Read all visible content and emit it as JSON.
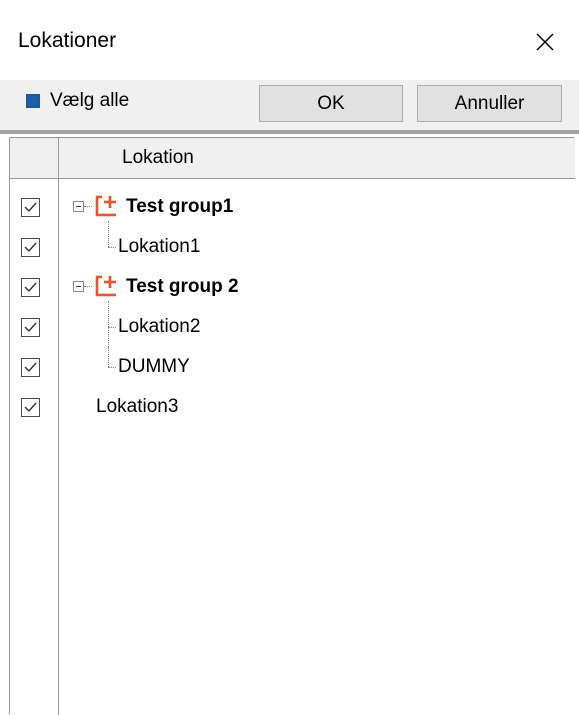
{
  "window": {
    "title": "Lokationer"
  },
  "toolbar": {
    "select_all_label": "Vælg alle",
    "ok_label": "OK",
    "cancel_label": "Annuller"
  },
  "grid": {
    "column_header": "Lokation",
    "rows": [
      {
        "label": "Test group1",
        "checked": true,
        "type": "group"
      },
      {
        "label": "Lokation1",
        "checked": true,
        "type": "child"
      },
      {
        "label": "Test group 2",
        "checked": true,
        "type": "group"
      },
      {
        "label": "Lokation2",
        "checked": true,
        "type": "child"
      },
      {
        "label": "DUMMY",
        "checked": true,
        "type": "child"
      },
      {
        "label": "Lokation3",
        "checked": true,
        "type": "root"
      }
    ]
  },
  "colors": {
    "group_icon": "#e8542b",
    "select_all_fill": "#1f5fa8",
    "toolbar_bg": "#f0f0f0",
    "button_bg": "#e1e1e1"
  },
  "icons": {
    "close": "close-icon",
    "group": "group-add-icon",
    "expander": "collapse-icon",
    "checkbox": "checkbox-checked-icon"
  }
}
